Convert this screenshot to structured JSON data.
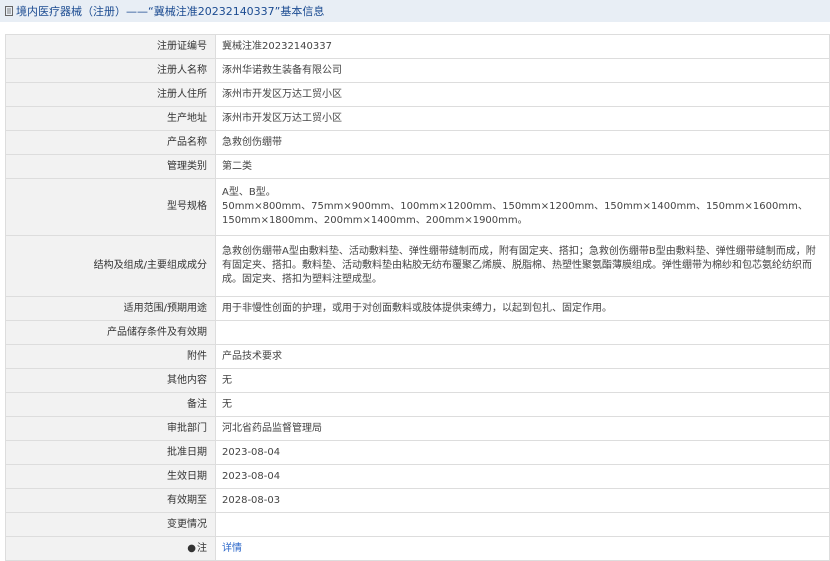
{
  "header": {
    "title": "境内医疗器械（注册）——“冀械注准20232140337”基本信息"
  },
  "rows": [
    {
      "label": "注册证编号",
      "value": "冀械注准20232140337"
    },
    {
      "label": "注册人名称",
      "value": "涿州华诺救生装备有限公司"
    },
    {
      "label": "注册人住所",
      "value": "涿州市开发区万达工贸小区"
    },
    {
      "label": "生产地址",
      "value": "涿州市开发区万达工贸小区"
    },
    {
      "label": "产品名称",
      "value": "急救创伤绷带"
    },
    {
      "label": "管理类别",
      "value": "第二类"
    },
    {
      "label": "型号规格",
      "value": "A型、B型。\n50mm×800mm、75mm×900mm、100mm×1200mm、150mm×1200mm、150mm×1400mm、150mm×1600mm、150mm×1800mm、200mm×1400mm、200mm×1900mm。"
    },
    {
      "label": "结构及组成/主要组成成分",
      "value": "急救创伤绷带A型由敷料垫、活动敷料垫、弹性绷带缝制而成，附有固定夹、搭扣；急救创伤绷带B型由敷料垫、弹性绷带缝制而成，附有固定夹、搭扣。敷料垫、活动敷料垫由粘胶无纺布覆聚乙烯膜、脱脂棉、热塑性聚氨酯薄膜组成。弹性绷带为棉纱和包芯氨纶纺织而成。固定夹、搭扣为塑料注塑成型。"
    },
    {
      "label": "适用范围/预期用途",
      "value": "用于非慢性创面的护理，或用于对创面敷料或肢体提供束缚力，以起到包扎、固定作用。"
    },
    {
      "label": "产品储存条件及有效期",
      "value": ""
    },
    {
      "label": "附件",
      "value": "产品技术要求"
    },
    {
      "label": "其他内容",
      "value": "无"
    },
    {
      "label": "备注",
      "value": "无"
    },
    {
      "label": "审批部门",
      "value": "河北省药品监督管理局"
    },
    {
      "label": "批准日期",
      "value": "2023-08-04"
    },
    {
      "label": "生效日期",
      "value": "2023-08-04"
    },
    {
      "label": "有效期至",
      "value": "2028-08-03"
    },
    {
      "label": "变更情况",
      "value": ""
    },
    {
      "label": "注",
      "value": "详情"
    }
  ]
}
